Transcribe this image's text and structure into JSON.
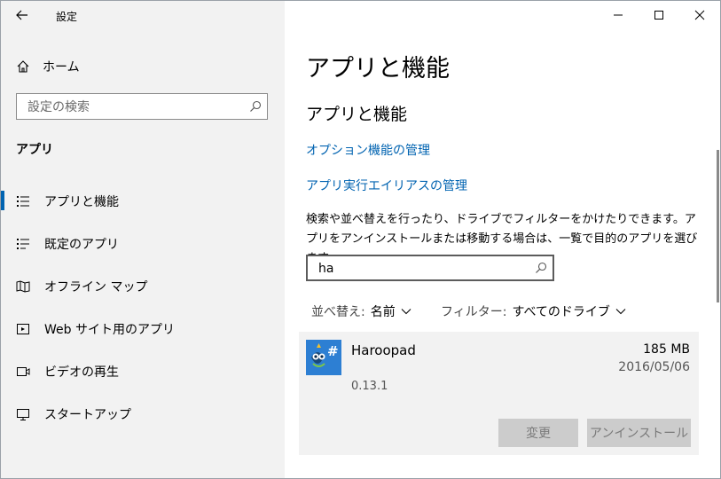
{
  "window": {
    "title": "設定"
  },
  "sidebar": {
    "home_label": "ホーム",
    "search_placeholder": "設定の検索",
    "section_header": "アプリ",
    "items": [
      {
        "label": "アプリと機能",
        "icon": "apps-features-icon",
        "active": true
      },
      {
        "label": "既定のアプリ",
        "icon": "default-apps-icon"
      },
      {
        "label": "オフライン マップ",
        "icon": "offline-maps-icon"
      },
      {
        "label": "Web サイト用のアプリ",
        "icon": "apps-for-websites-icon"
      },
      {
        "label": "ビデオの再生",
        "icon": "video-playback-icon"
      },
      {
        "label": "スタートアップ",
        "icon": "startup-icon"
      }
    ]
  },
  "main": {
    "page_title": "アプリと機能",
    "sub_title": "アプリと機能",
    "links": {
      "optional_features": "オプション機能の管理",
      "app_execution_aliases": "アプリ実行エイリアスの管理"
    },
    "description": "検索や並べ替えを行ったり、ドライブでフィルターをかけたりできます。アプリをアンインストールまたは移動する場合は、一覧で目的のアプリを選びます。",
    "filter_value": "ha",
    "sort": {
      "label": "並べ替え:",
      "value": "名前"
    },
    "filter": {
      "label": "フィルター:",
      "value": "すべてのドライブ"
    },
    "app": {
      "name": "Haroopad",
      "size": "185 MB",
      "date": "2016/05/06",
      "version": "0.13.1",
      "modify_label": "変更",
      "uninstall_label": "アンインストール"
    }
  },
  "colors": {
    "accent": "#0063b1",
    "sidebar_bg": "#f2f2f2",
    "app_icon_bg": "#2d7fd3"
  }
}
